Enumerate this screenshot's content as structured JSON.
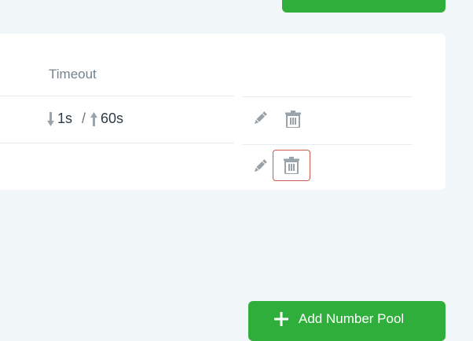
{
  "colors": {
    "accent": "#2fae3b",
    "background": "#f1f6f9",
    "card": "#ffffff",
    "icon": "#9aa3aa",
    "focus_border": "#cd5a4e"
  },
  "table": {
    "headers": {
      "timeout": "Timeout"
    },
    "rows": [
      {
        "timeout": {
          "down_icon": "arrow-down-icon",
          "down": "1s",
          "separator": "/",
          "up_icon": "arrow-up-icon",
          "up": "60s"
        },
        "actions": [
          {
            "icon": "pencil-icon"
          },
          {
            "icon": "trash-icon"
          }
        ]
      },
      {
        "timeout": {
          "down": "",
          "up": ""
        },
        "actions": [
          {
            "icon": "pencil-icon"
          },
          {
            "icon": "trash-icon",
            "focused": true
          }
        ]
      }
    ]
  },
  "footer": {
    "add_number_pool": {
      "label": "Add Number Pool",
      "icon": "plus-icon"
    }
  }
}
